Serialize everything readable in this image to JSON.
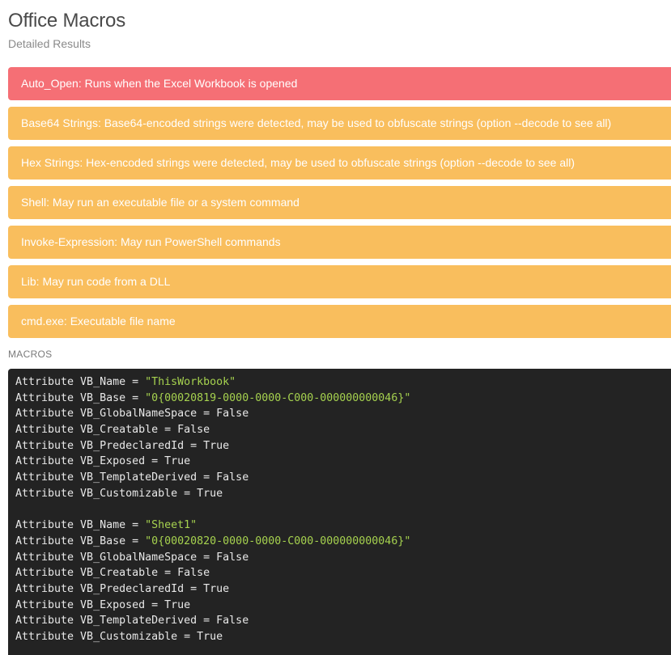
{
  "header": {
    "title": "Office Macros",
    "subtitle": "Detailed Results"
  },
  "alerts": [
    {
      "severity": "danger",
      "text": "Auto_Open: Runs when the Excel Workbook is opened"
    },
    {
      "severity": "warning",
      "text": "Base64 Strings: Base64-encoded strings were detected, may be used to obfuscate strings (option --decode to see all)"
    },
    {
      "severity": "warning",
      "text": "Hex Strings: Hex-encoded strings were detected, may be used to obfuscate strings (option --decode to see all)"
    },
    {
      "severity": "warning",
      "text": "Shell: May run an executable file or a system command"
    },
    {
      "severity": "warning",
      "text": "Invoke-Expression: May run PowerShell commands"
    },
    {
      "severity": "warning",
      "text": "Lib: May run code from a DLL"
    },
    {
      "severity": "warning",
      "text": "cmd.exe: Executable file name"
    }
  ],
  "colors": {
    "danger": "#f56f75",
    "warning": "#f9be5d",
    "code_bg": "#232323",
    "code_string": "#a6d24f"
  },
  "macros": {
    "label": "MACROS",
    "lines": [
      {
        "pre": "Attribute VB_Name = ",
        "str": "\"ThisWorkbook\"",
        "post": ""
      },
      {
        "pre": "Attribute VB_Base = ",
        "str": "\"0{00020819-0000-0000-C000-000000000046}\"",
        "post": ""
      },
      {
        "pre": "Attribute VB_GlobalNameSpace = False",
        "str": "",
        "post": ""
      },
      {
        "pre": "Attribute VB_Creatable = False",
        "str": "",
        "post": ""
      },
      {
        "pre": "Attribute VB_PredeclaredId = True",
        "str": "",
        "post": ""
      },
      {
        "pre": "Attribute VB_Exposed = True",
        "str": "",
        "post": ""
      },
      {
        "pre": "Attribute VB_TemplateDerived = False",
        "str": "",
        "post": ""
      },
      {
        "pre": "Attribute VB_Customizable = True",
        "str": "",
        "post": ""
      },
      {
        "pre": "",
        "str": "",
        "post": ""
      },
      {
        "pre": "Attribute VB_Name = ",
        "str": "\"Sheet1\"",
        "post": ""
      },
      {
        "pre": "Attribute VB_Base = ",
        "str": "\"0{00020820-0000-0000-C000-000000000046}\"",
        "post": ""
      },
      {
        "pre": "Attribute VB_GlobalNameSpace = False",
        "str": "",
        "post": ""
      },
      {
        "pre": "Attribute VB_Creatable = False",
        "str": "",
        "post": ""
      },
      {
        "pre": "Attribute VB_PredeclaredId = True",
        "str": "",
        "post": ""
      },
      {
        "pre": "Attribute VB_Exposed = True",
        "str": "",
        "post": ""
      },
      {
        "pre": "Attribute VB_TemplateDerived = False",
        "str": "",
        "post": ""
      },
      {
        "pre": "Attribute VB_Customizable = True",
        "str": "",
        "post": ""
      }
    ]
  }
}
